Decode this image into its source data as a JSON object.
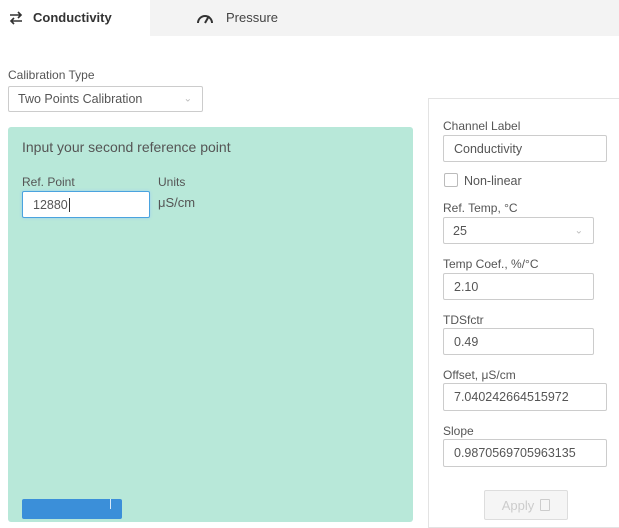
{
  "tabs": [
    {
      "label": "Conductivity",
      "icon": "swap-arrows-icon",
      "active": true
    },
    {
      "label": "Pressure",
      "icon": "gauge-icon",
      "active": false
    }
  ],
  "calibration": {
    "type_label": "Calibration Type",
    "type_value": "Two Points Calibration"
  },
  "reference": {
    "title": "Input your second reference point",
    "ref_point_label": "Ref. Point",
    "ref_point_value": "12880",
    "units_label": "Units",
    "units_value": "μS/cm"
  },
  "channel": {
    "label_title": "Channel Label",
    "label_value": "Conductivity",
    "nonlinear_label": "Non-linear",
    "ref_temp_label": "Ref. Temp, °C",
    "ref_temp_value": "25",
    "temp_coef_label": "Temp Coef., %/°C",
    "temp_coef_value": "2.10",
    "tds_label": "TDSfctr",
    "tds_value": "0.49",
    "offset_label": "Offset, μS/cm",
    "offset_value": "7.040242664515972",
    "slope_label": "Slope",
    "slope_value": "0.9870569705963135",
    "apply_label": "Apply"
  },
  "colors": {
    "panel_green": "#b8e8d9",
    "accent_blue": "#3b8fd9",
    "focus_blue": "#4aa3df"
  }
}
